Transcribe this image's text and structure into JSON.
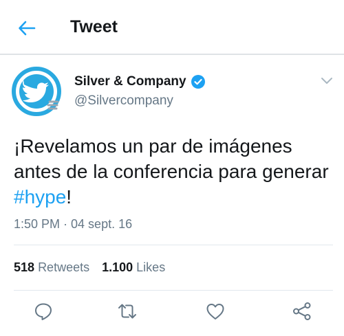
{
  "header": {
    "title": "Tweet"
  },
  "tweet": {
    "author_name": "Silver & Company",
    "handle": "@Silvercompany",
    "text_before": "¡Revelamos un par de imágenes antes de la conferencia para generar ",
    "hashtag": "#hype",
    "text_after": "!",
    "timestamp": "1:50 PM · 04 sept. 16"
  },
  "stats": {
    "retweets_count": "518",
    "retweets_label": "Retweets",
    "likes_count": "1.100",
    "likes_label": "Likes"
  },
  "icons": {
    "back": "arrow-left-icon",
    "verified": "verified-badge-icon",
    "menu": "chevron-down-icon",
    "reply": "reply-icon",
    "retweet": "retweet-icon",
    "like": "heart-icon",
    "share": "share-icon"
  },
  "colors": {
    "accent": "#1da1f2",
    "secondary_text": "#657786",
    "border": "#e1e8ed"
  }
}
